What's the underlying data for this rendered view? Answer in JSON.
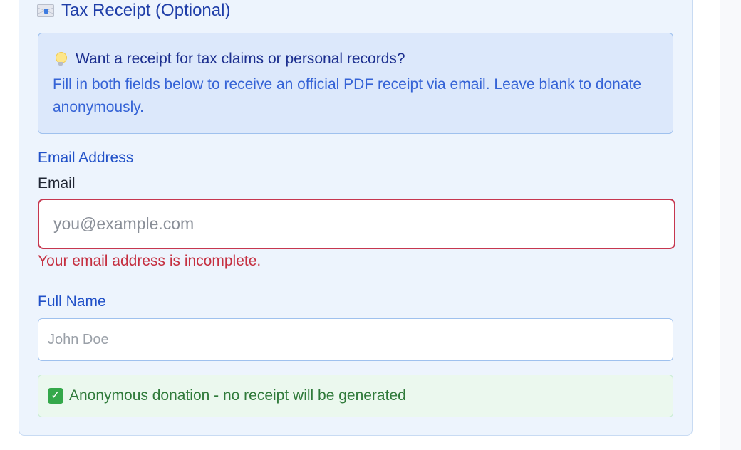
{
  "section": {
    "icon": "envelope-icon",
    "title": "Tax Receipt (Optional)"
  },
  "info": {
    "icon": "lightbulb-icon",
    "heading": "Want a receipt for tax claims or personal records?",
    "body": "Fill in both fields below to receive an official PDF receipt via email. Leave blank to donate anonymously."
  },
  "email": {
    "section_label": "Email Address",
    "field_label": "Email",
    "placeholder": "you@example.com",
    "value": "",
    "error": "Your email address is incomplete."
  },
  "full_name": {
    "label": "Full Name",
    "placeholder": "John Doe",
    "value": ""
  },
  "status": {
    "icon": "check-mark-icon",
    "check_glyph": "✓",
    "message": "Anonymous donation - no receipt will be generated"
  },
  "colors": {
    "accent": "#2151c8",
    "error": "#c53041",
    "success": "#2f7a3a",
    "panel_background": "#edf4fd"
  }
}
